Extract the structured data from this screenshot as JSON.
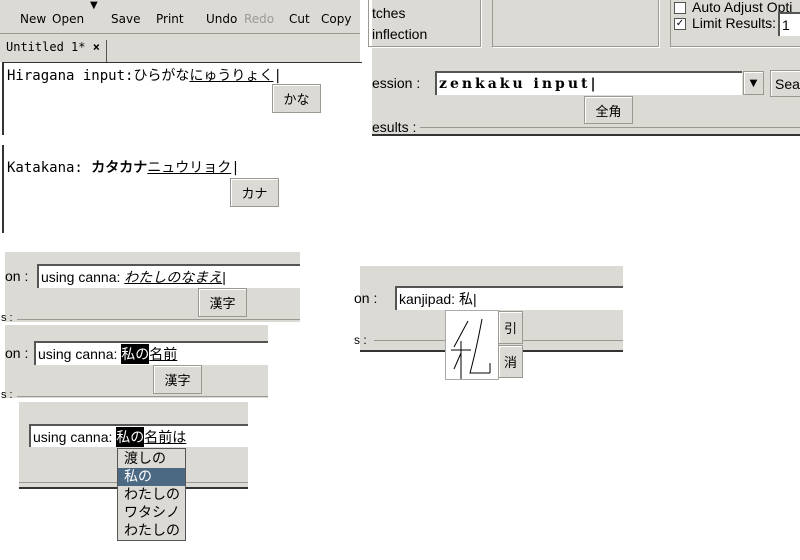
{
  "editor": {
    "toolbar": [
      "New",
      "Open",
      "Save",
      "Print",
      "Undo",
      "Redo",
      "Cut",
      "Copy"
    ],
    "tab": "Untitled 1*",
    "tab_close": "×",
    "hiragana_prefix": "Hiragana input:",
    "hiragana_committed": "ひらがな",
    "hiragana_preedit": "にゅうりょく",
    "kana_button": "かな"
  },
  "katakana": {
    "prefix": "Katakana: ",
    "committed": "カタカナ",
    "preedit": "ニュウリョク",
    "button": "カナ"
  },
  "search": {
    "opt1": "tches",
    "opt2": "inflection",
    "auto_adjust": "Auto Adjust Opti",
    "limit_results": "Limit Results:",
    "limit_value": "1",
    "expression_label": "ession :",
    "expression_value": "zenkaku input",
    "search_button": "Sea",
    "zenkaku_button": "全角",
    "results_label": "esults :",
    "limit_checked": true,
    "auto_checked": false
  },
  "canna1": {
    "label": "on :",
    "prefix": "using canna: ",
    "preedit": "わたしのなまえ",
    "button": "漢字",
    "results_label": "s :"
  },
  "canna2": {
    "label": "on :",
    "prefix": "using canna: ",
    "selected": "私の",
    "rest": "名前",
    "button": "漢字",
    "results_label": "s :"
  },
  "canna3": {
    "prefix": "using canna: ",
    "selected": "私の",
    "rest": "名前は",
    "candidates": [
      "渡しの",
      "私の",
      "わたしの",
      "ワタシノ",
      "わたしの"
    ],
    "selected_index": 1,
    "highlight_color": "#4b6983"
  },
  "kanjipad": {
    "label": "on :",
    "prefix": "kanjipad: ",
    "value": "私",
    "results_label": "s :",
    "lookup_button": "引",
    "clear_button": "消"
  }
}
